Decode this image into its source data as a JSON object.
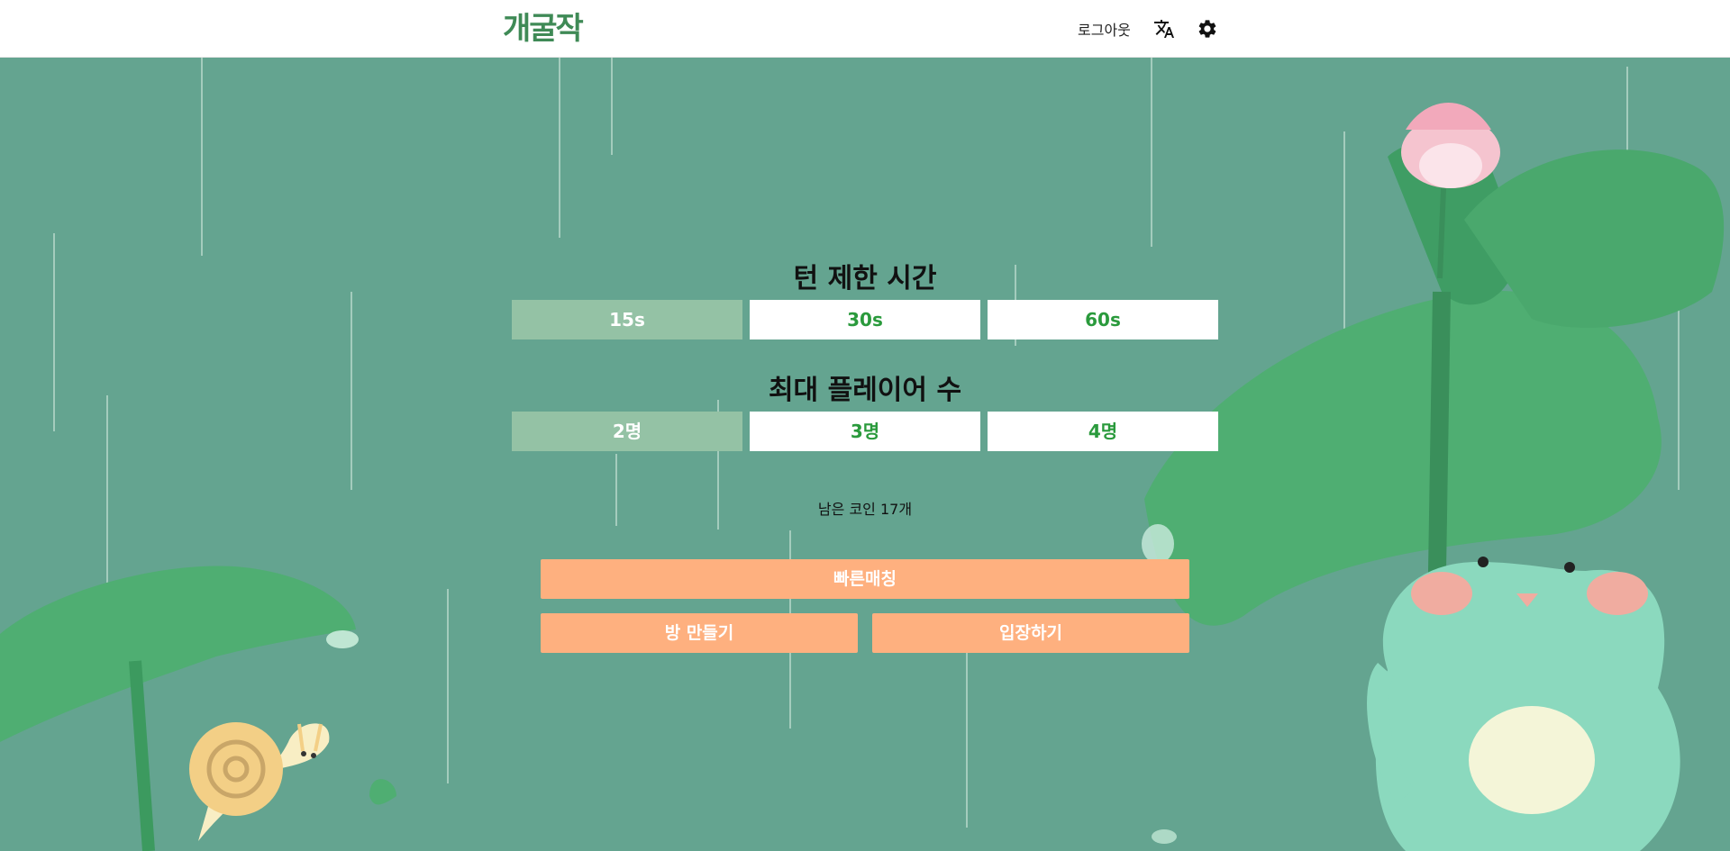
{
  "header": {
    "logo": "개굴작",
    "logout_label": "로그아웃",
    "translate_icon": "translate-icon",
    "settings_icon": "gear-icon"
  },
  "turn_time": {
    "title": "턴 제한 시간",
    "options": [
      "15s",
      "30s",
      "60s"
    ],
    "selected": "15s"
  },
  "max_players": {
    "title": "최대 플레이어 수",
    "options": [
      "2명",
      "3명",
      "4명"
    ],
    "selected": "2명"
  },
  "coins_text": "남은 코인 17개",
  "actions": {
    "quick_match": "빠른매칭",
    "create_room": "방 만들기",
    "join_room": "입장하기"
  },
  "colors": {
    "background": "#64a490",
    "selected_option": "#94c2a5",
    "option_text": "#2a9a3c",
    "action_button": "#feb07f"
  }
}
